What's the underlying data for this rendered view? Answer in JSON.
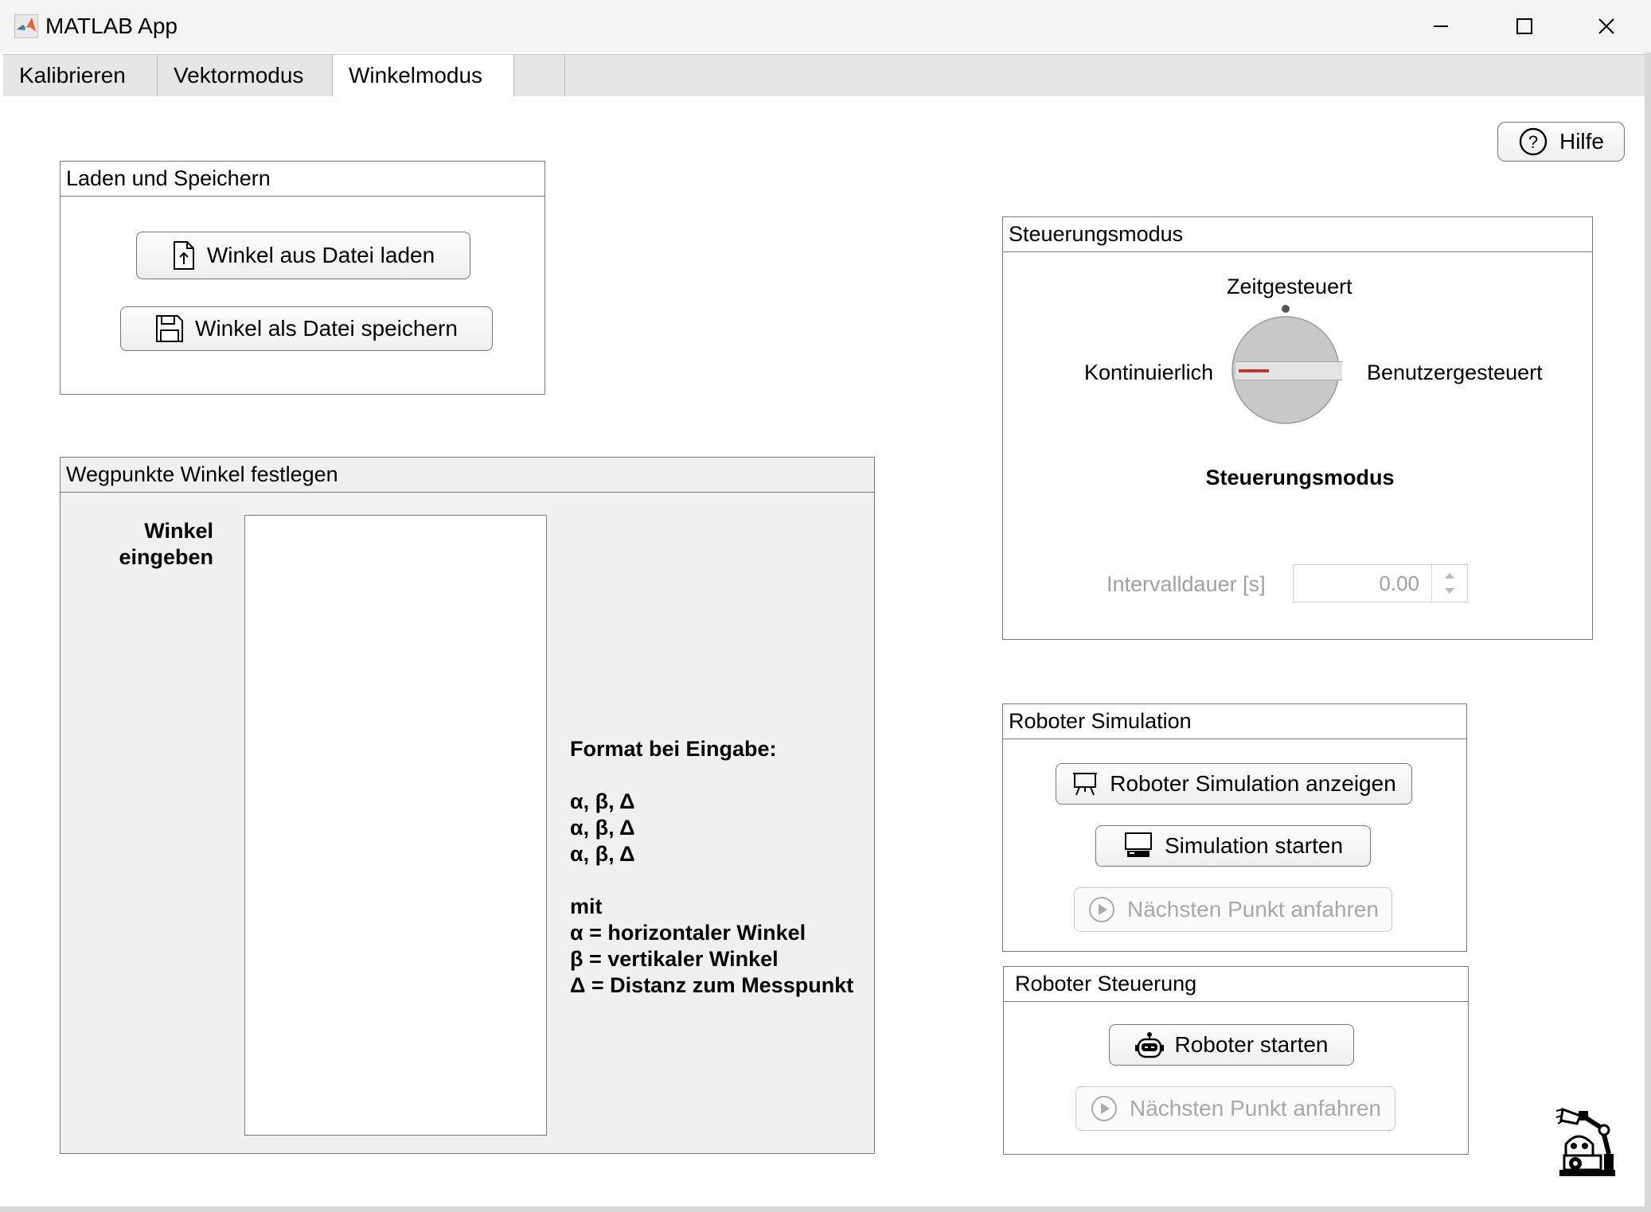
{
  "window": {
    "title": "MATLAB App",
    "minimize_glyph": "—",
    "close_glyph": "✕"
  },
  "tabs": [
    {
      "label": "Kalibrieren",
      "active": false
    },
    {
      "label": "Vektormodus",
      "active": false
    },
    {
      "label": "Winkelmodus",
      "active": true
    }
  ],
  "help": {
    "label": "Hilfe",
    "icon": "question-circle-icon"
  },
  "load_save": {
    "title": "Laden und Speichern",
    "load_label": "Winkel aus Datei laden",
    "save_label": "Winkel als Datei speichern"
  },
  "waypoints": {
    "title": "Wegpunkte Winkel festlegen",
    "input_label_1": "Winkel",
    "input_label_2": "eingeben",
    "input_value": "",
    "format_heading": "Format bei Eingabe:",
    "format_lines": [
      "α, β, Δ",
      "α, β, Δ",
      "α, β, Δ"
    ],
    "mit": "mit",
    "legend": [
      "α = horizontaler Winkel",
      "β = vertikaler Winkel",
      "Δ = Distanz zum Messpunkt"
    ]
  },
  "control_mode": {
    "title": "Steuerungsmodus",
    "knob_positions": [
      "Zeitgesteuert",
      "Kontinuierlich",
      "Benutzergesteuert"
    ],
    "selected": "Kontinuierlich",
    "knob_label": "Steuerungsmodus",
    "interval_label": "Intervalldauer [s]",
    "interval_value": "0.00",
    "accent_color": "#c0392b"
  },
  "simulation": {
    "title": "Roboter Simulation",
    "show_label": "Roboter Simulation anzeigen",
    "start_label": "Simulation starten",
    "next_label": "Nächsten Punkt anfahren"
  },
  "control": {
    "title": "Roboter Steuerung",
    "start_label": "Roboter starten",
    "next_label": "Nächsten Punkt anfahren"
  }
}
